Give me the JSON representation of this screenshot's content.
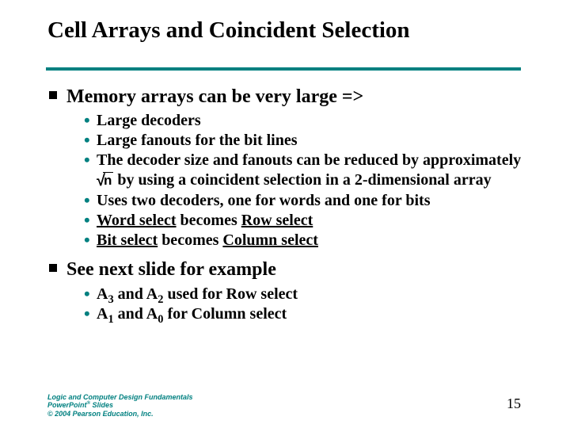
{
  "title": "Cell Arrays and Coincident Selection",
  "body": {
    "p1": {
      "text": "Memory arrays can be very large =>",
      "items": {
        "i1": "Large decoders",
        "i2": "Large fanouts for the bit lines",
        "i3a": "The decoder size and fanouts can be reduced by approximately ",
        "i3_radicand": "n",
        "i3b": " by using a coincident selection in a 2-dimensional array",
        "i4": "Uses two decoders, one for words and one for bits",
        "i5a": "Word select",
        "i5b": " becomes ",
        "i5c": "Row select",
        "i6a": "Bit select",
        "i6b": " becomes ",
        "i6c": "Column select"
      }
    },
    "p2": {
      "text": "See next slide for example",
      "items": {
        "i1a": "A",
        "i1s1": "3",
        "i1b": " and A",
        "i1s2": "2",
        "i1c": " used for Row select",
        "i2a": "A",
        "i2s1": "1",
        "i2b": " and A",
        "i2s2": "0",
        "i2c": " for Column select"
      }
    }
  },
  "footer": {
    "line1": "Logic and Computer Design Fundamentals",
    "line2a": "PowerPoint",
    "line2sup": "®",
    "line2b": " Slides",
    "line3": "© 2004 Pearson Education, Inc."
  },
  "page_number": "15"
}
